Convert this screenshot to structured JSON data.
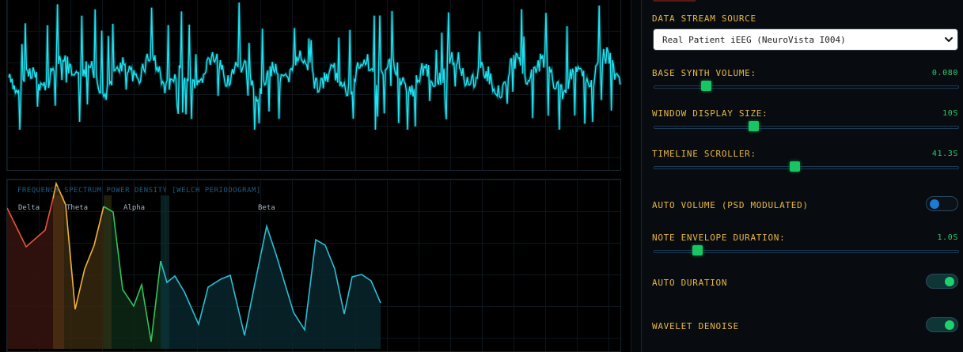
{
  "visual": {
    "psd_title": "FREQUENCY SPECTRUM POWER DENSITY [WELCH PERIODOGRAM]",
    "bands": [
      {
        "name": "Delta",
        "color": "#e8553c"
      },
      {
        "name": "Theta",
        "color": "#f0b23a"
      },
      {
        "name": "Alpha",
        "color": "#2fc45a"
      },
      {
        "name": "Beta",
        "color": "#2ac0d6"
      }
    ],
    "wave_color": "#1fe3f2"
  },
  "controls": {
    "data_source": {
      "label": "DATA STREAM SOURCE",
      "selected": "Real Patient iEEG (NeuroVista I004)"
    },
    "base_synth_volume": {
      "label": "BASE SYNTH VOLUME:",
      "value": "0.080",
      "level": 0.16
    },
    "window_display_size": {
      "label": "WINDOW DISPLAY SIZE:",
      "value": "10S",
      "level": 0.32
    },
    "timeline_scroller": {
      "label": "TIMELINE SCROLLER:",
      "value": "41.3S",
      "level": 0.46
    },
    "auto_volume": {
      "label": "AUTO VOLUME (PSD MODULATED)",
      "on": false
    },
    "note_envelope_duration": {
      "label": "NOTE ENVELOPE DURATION:",
      "value": "1.0S",
      "level": 0.13
    },
    "auto_duration": {
      "label": "AUTO DURATION",
      "on": true
    },
    "wavelet_denoise": {
      "label": "WAVELET DENOISE",
      "on": true
    }
  },
  "colors": {
    "label": "#e7b642",
    "value": "#27cc6a",
    "slider_thumb": "#18c563"
  }
}
